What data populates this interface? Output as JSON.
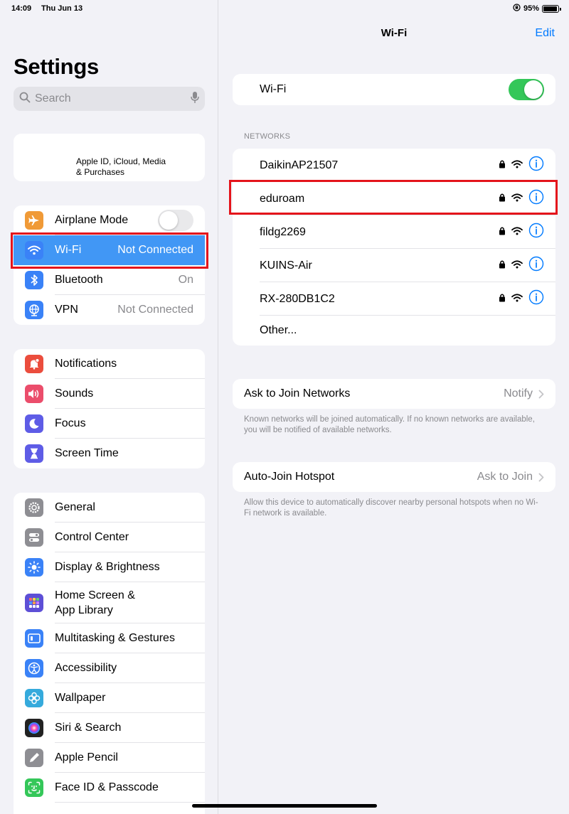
{
  "status_bar": {
    "time": "14:09",
    "date": "Thu Jun 13",
    "battery": "95%"
  },
  "sidebar": {
    "title": "Settings",
    "search": {
      "placeholder": "Search"
    },
    "apple_id": {
      "line1": "Apple ID, iCloud, Media",
      "line2": "& Purchases"
    },
    "connectivity": [
      {
        "label": "Airplane Mode",
        "icon": "airplane-icon",
        "color": "#f09a37",
        "toggle": false
      },
      {
        "label": "Wi-Fi",
        "value": "Not Connected",
        "icon": "wifi-icon",
        "color": "#3a82f7",
        "selected": true
      },
      {
        "label": "Bluetooth",
        "value": "On",
        "icon": "bluetooth-icon",
        "color": "#3a82f7"
      },
      {
        "label": "VPN",
        "value": "Not Connected",
        "icon": "vpn-globe-icon",
        "color": "#3a82f7"
      }
    ],
    "notifications_group": [
      {
        "label": "Notifications",
        "icon": "notifications-bell-icon",
        "color": "#eb4d3d"
      },
      {
        "label": "Sounds",
        "icon": "speaker-icon",
        "color": "#eb4d6b"
      },
      {
        "label": "Focus",
        "icon": "moon-icon",
        "color": "#5e5ce6"
      },
      {
        "label": "Screen Time",
        "icon": "hourglass-icon",
        "color": "#5e5ce6"
      }
    ],
    "general_group": [
      {
        "label": "General",
        "icon": "gear-icon",
        "color": "#8e8e93"
      },
      {
        "label": "Control Center",
        "icon": "switches-icon",
        "color": "#8e8e93"
      },
      {
        "label": "Display & Brightness",
        "icon": "sun-icon",
        "color": "#3a82f7"
      },
      {
        "label1": "Home Screen &",
        "label2": "App Library",
        "icon": "app-grid-icon",
        "color": "#5d4fd6"
      },
      {
        "label": "Multitasking & Gestures",
        "icon": "multitasking-icon",
        "color": "#3a82f7"
      },
      {
        "label": "Accessibility",
        "icon": "accessibility-icon",
        "color": "#3a82f7"
      },
      {
        "label": "Wallpaper",
        "icon": "flower-icon",
        "color": "#35aadc"
      },
      {
        "label": "Siri & Search",
        "icon": "siri-icon",
        "color": "#222222"
      },
      {
        "label": "Apple Pencil",
        "icon": "pencil-icon",
        "color": "#8e8e93"
      },
      {
        "label": "Face ID & Passcode",
        "icon": "face-id-icon",
        "color": "#34c759"
      }
    ]
  },
  "detail": {
    "title": "Wi-Fi",
    "edit_label": "Edit",
    "wifi_toggle": {
      "label": "Wi-Fi",
      "on": true
    },
    "networks_header": "NETWORKS",
    "networks": [
      "DaikinAP21507",
      "eduroam",
      "fildg2269",
      "KUINS-Air",
      "RX-280DB1C2"
    ],
    "other_label": "Other...",
    "ask_to_join": {
      "label": "Ask to Join Networks",
      "value": "Notify",
      "footnote": "Known networks will be joined automatically. If no known networks are available, you will be notified of available networks."
    },
    "auto_join": {
      "label": "Auto-Join Hotspot",
      "value": "Ask to Join",
      "footnote": "Allow this device to automatically discover nearby personal hotspots when no Wi-Fi network is available."
    }
  },
  "colors": {
    "accent": "#007aff",
    "highlight": "#e4141b",
    "toggle_on": "#34c759",
    "selected_row": "#4197f5"
  }
}
